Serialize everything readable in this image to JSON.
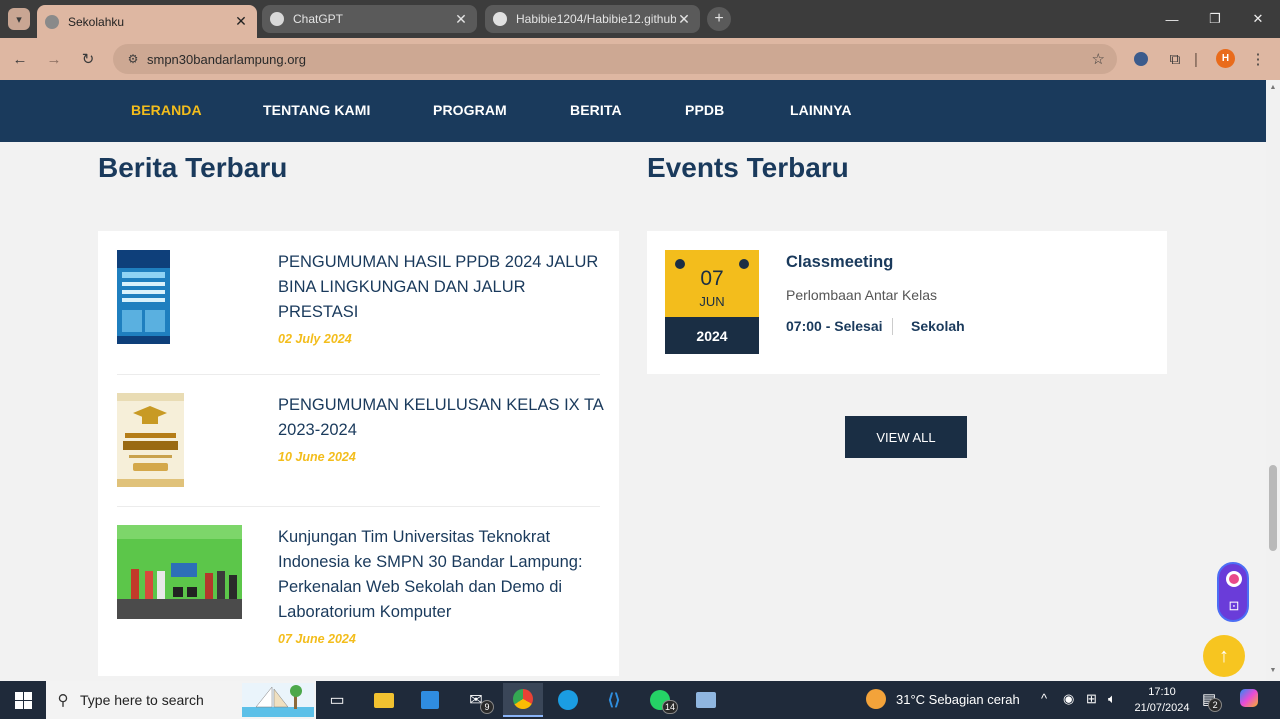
{
  "browser": {
    "tabs": [
      {
        "title": "Sekolahku",
        "active": true
      },
      {
        "title": "ChatGPT",
        "active": false
      },
      {
        "title": "Habibie1204/Habibie12.github.io",
        "active": false
      }
    ],
    "url": "smpn30bandarlampung.org",
    "profile_initial": "H"
  },
  "nav": {
    "items": [
      "BERANDA",
      "TENTANG KAMI",
      "PROGRAM",
      "BERITA",
      "PPDB",
      "LAINNYA"
    ],
    "active_index": 0
  },
  "news": {
    "heading": "Berita Terbaru",
    "items": [
      {
        "title": "PENGUMUMAN HASIL PPDB 2024 JALUR BINA LINGKUNGAN DAN JALUR PRESTASI",
        "date": "02 July 2024"
      },
      {
        "title": "PENGUMUMAN KELULUSAN KELAS IX TA 2023-2024",
        "date": "10 June 2024"
      },
      {
        "title": "Kunjungan Tim Universitas Teknokrat Indonesia ke SMPN 30 Bandar Lampung: Perkenalan Web Sekolah dan Demo di Laboratorium Komputer",
        "date": "07 June 2024"
      }
    ]
  },
  "events": {
    "heading": "Events Terbaru",
    "items": [
      {
        "day": "07",
        "month": "JUN",
        "year": "2024",
        "title": "Classmeeting",
        "description": "Perlombaan Antar Kelas",
        "time": "07:00 - Selesai",
        "location": "Sekolah"
      }
    ],
    "view_all_label": "VIEW ALL"
  },
  "taskbar": {
    "search_placeholder": "Type here to search",
    "apps": [
      {
        "name": "task-view-icon",
        "badge": ""
      },
      {
        "name": "file-explorer-icon",
        "badge": ""
      },
      {
        "name": "microsoft-store-icon",
        "badge": ""
      },
      {
        "name": "mail-icon",
        "badge": "9"
      },
      {
        "name": "chrome-icon",
        "badge": ""
      },
      {
        "name": "edge-icon",
        "badge": ""
      },
      {
        "name": "vscode-icon",
        "badge": ""
      },
      {
        "name": "whatsapp-icon",
        "badge": "14"
      },
      {
        "name": "control-panel-icon",
        "badge": ""
      }
    ],
    "weather": "31°C  Sebagian cerah",
    "time": "17:10",
    "date": "21/07/2024",
    "notifications": "2"
  },
  "colors": {
    "nav_bg": "#1a3a5c",
    "accent_yellow": "#f3bd1c",
    "navy": "#1a2e44",
    "tab_active": "#deb7a2"
  }
}
